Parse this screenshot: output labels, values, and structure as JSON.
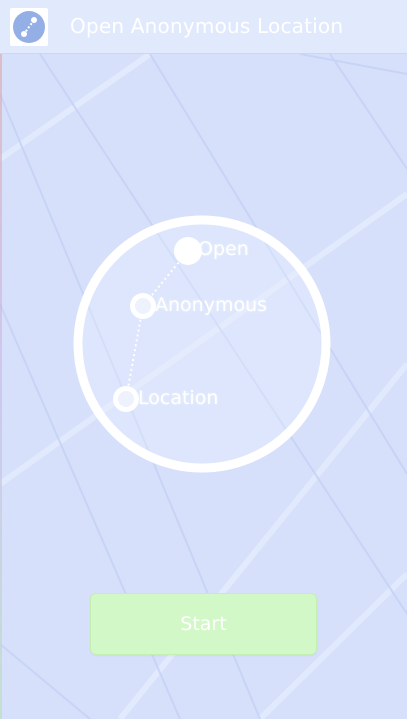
{
  "header": {
    "title": "Open Anonymous Location",
    "icon": "route-icon"
  },
  "map": {
    "labels": [
      "Open",
      "Anonymous",
      "Location"
    ]
  },
  "actions": {
    "start_label": "Start"
  },
  "colors": {
    "header_bg": "#e1e9fd",
    "map_bg": "#d6e0fb",
    "start_button_bg": "#d3f8c7"
  }
}
